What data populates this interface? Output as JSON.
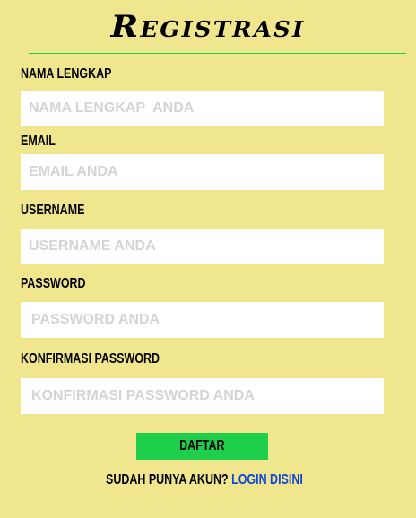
{
  "form": {
    "title": "Registrasi",
    "fields": [
      {
        "label": "NAMA LENGKAP",
        "placeholder": "NAMA LENGKAP  ANDA",
        "value": ""
      },
      {
        "label": "EMAIL",
        "placeholder": "EMAIL ANDA",
        "value": ""
      },
      {
        "label": "USERNAME",
        "placeholder": "USERNAME ANDA",
        "value": ""
      },
      {
        "label": "PASSWORD",
        "placeholder": "PASSWORD ANDA",
        "value": ""
      },
      {
        "label": "KONFIRMASI PASSWORD",
        "placeholder": "KONFIRMASI PASSWORD ANDA",
        "value": ""
      }
    ],
    "submit_label": "DAFTAR",
    "login_prompt": "SUDAH PUNYA AKUN?",
    "login_link": "LOGIN DISINI"
  },
  "colors": {
    "background": "#efe68e",
    "accent_green": "#1fce4b",
    "link_blue": "#1146d9",
    "field_bg": "#ffffff"
  }
}
